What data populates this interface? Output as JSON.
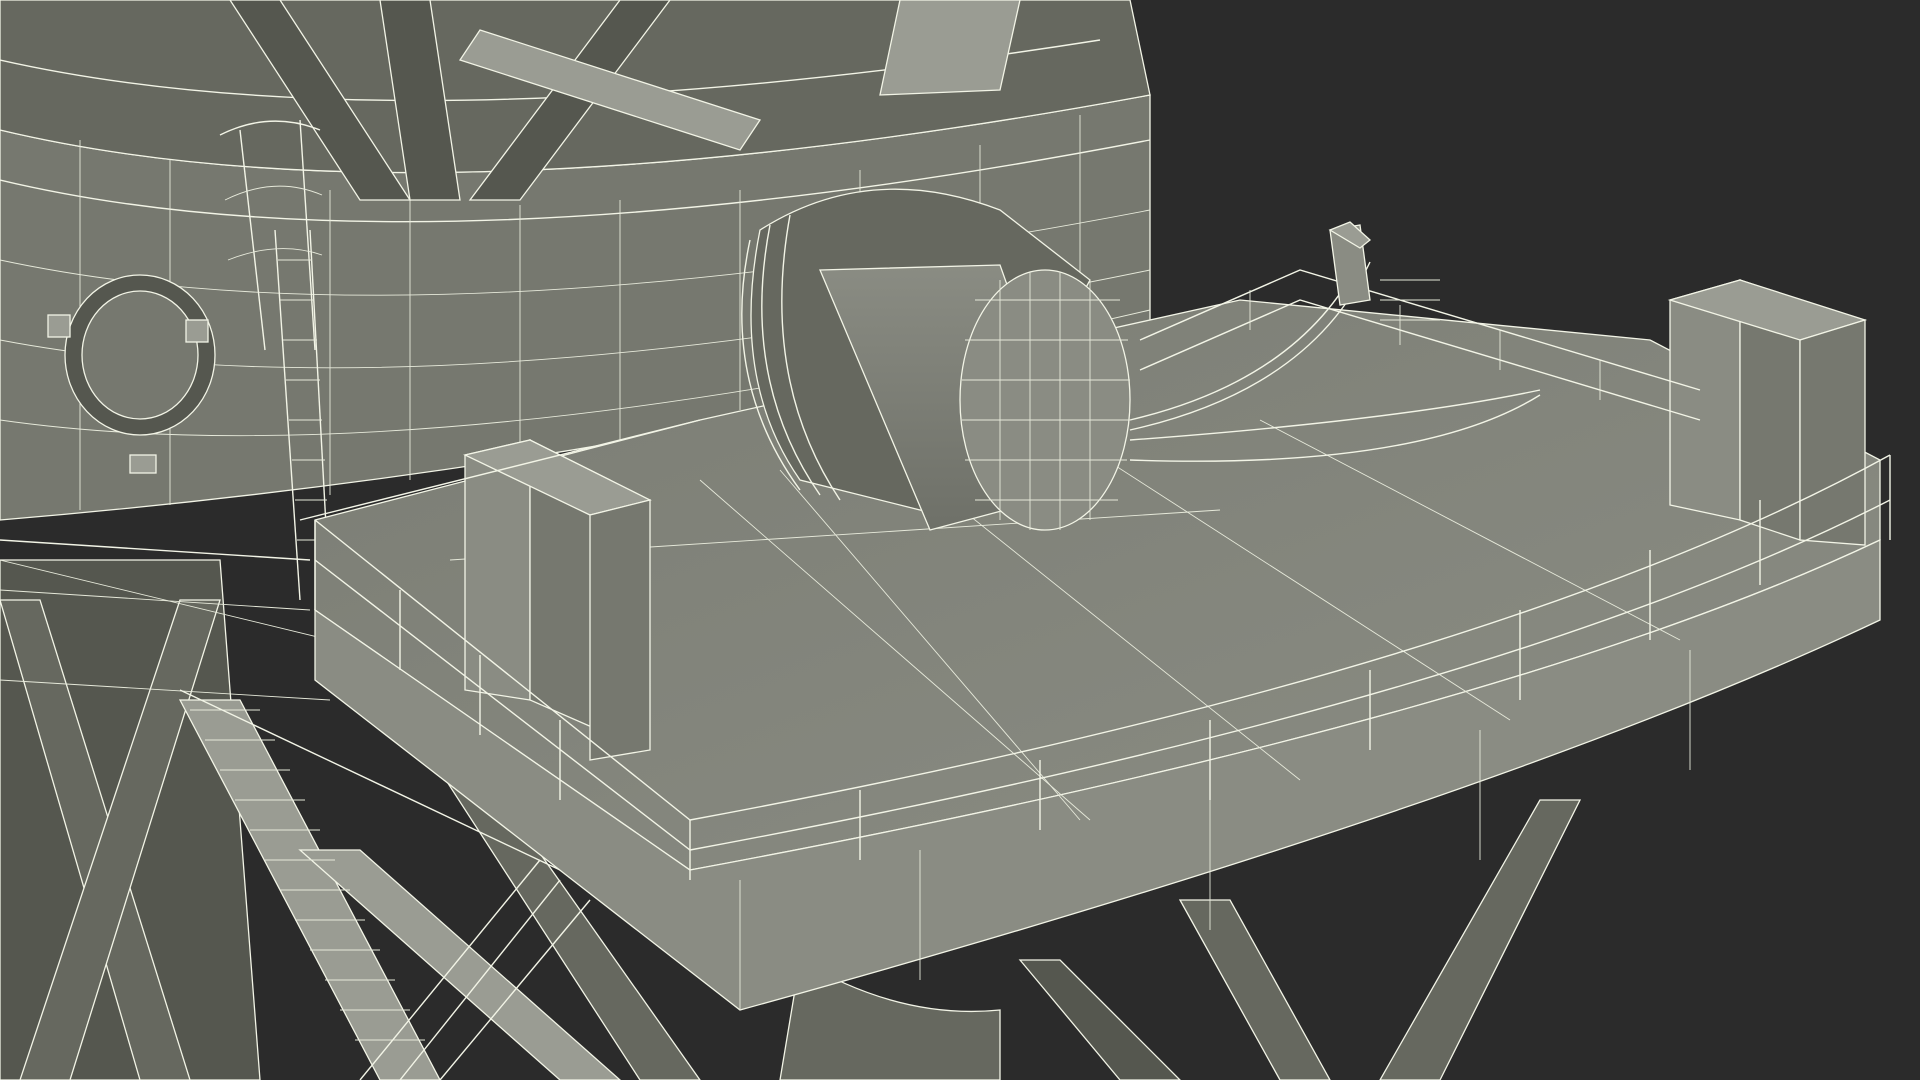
{
  "scene": {
    "background": "#2b2b2b",
    "model_fill": "#7d7f76",
    "wire_color": "#f2f4e6"
  }
}
